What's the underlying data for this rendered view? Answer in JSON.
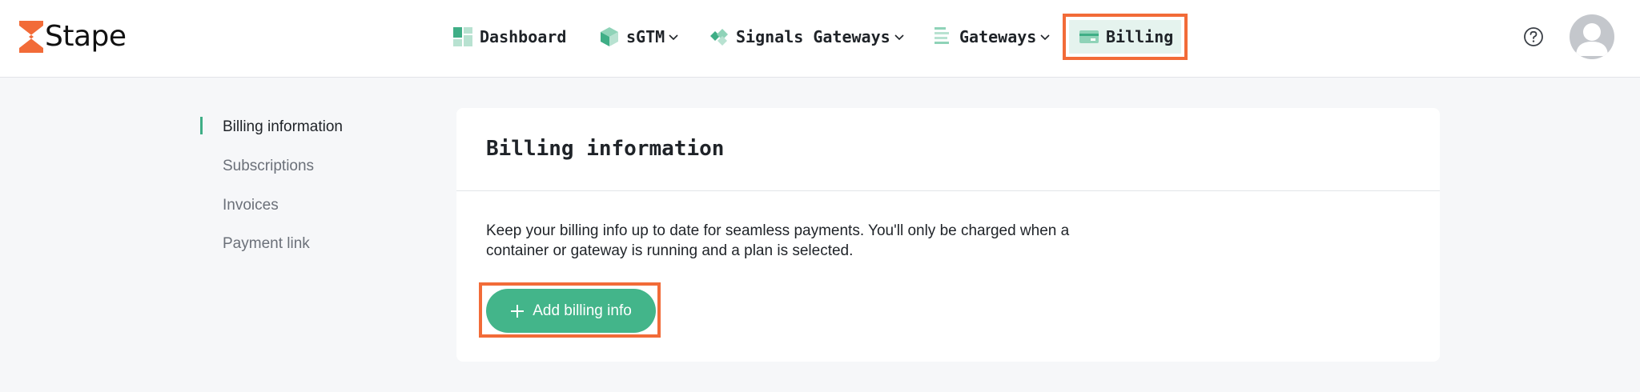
{
  "brand": {
    "name": "Stape"
  },
  "nav": {
    "dashboard": "Dashboard",
    "sgtm": "sGTM",
    "signals_gateways": "Signals Gateways",
    "gateways": "Gateways",
    "billing": "Billing"
  },
  "sidebar": {
    "items": [
      {
        "label": "Billing information"
      },
      {
        "label": "Subscriptions"
      },
      {
        "label": "Invoices"
      },
      {
        "label": "Payment link"
      }
    ]
  },
  "card": {
    "title": "Billing information",
    "description": "Keep your billing info up to date for seamless payments. You'll only be charged when a container or gateway is running and a plan is selected.",
    "add_button": "Add billing info"
  },
  "colors": {
    "accent": "#43b58a",
    "brand_orange": "#f26b38",
    "active_bg": "#e5f3ee"
  },
  "icons": {
    "dashboard": "dashboard-grid-icon",
    "sgtm": "cube-icon",
    "signals": "diamond-icon",
    "gateways": "list-icon",
    "billing": "credit-card-icon",
    "help": "question-circle-icon",
    "avatar": "user-avatar-icon"
  }
}
